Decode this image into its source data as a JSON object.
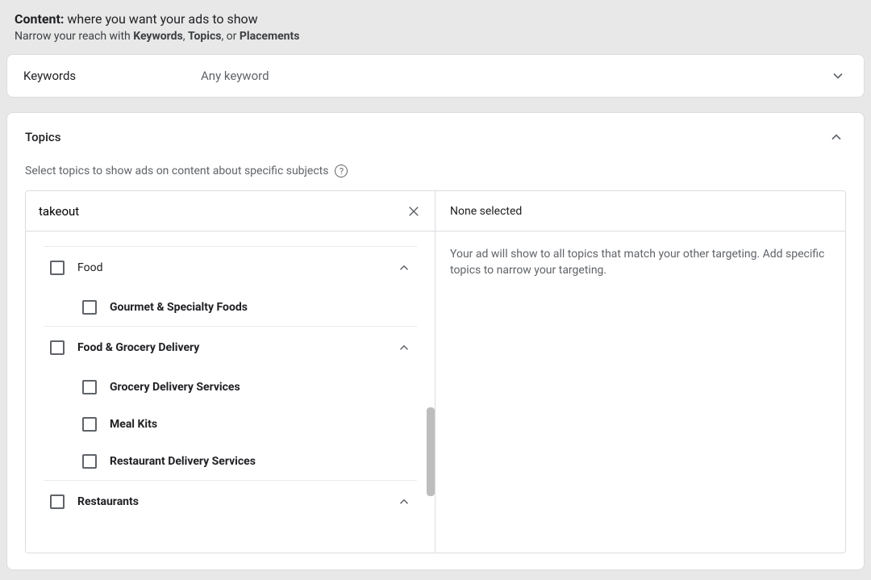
{
  "header": {
    "title_bold": "Content:",
    "title_rest": " where you want your ads to show",
    "sub_prefix": "Narrow your reach with ",
    "sub_k": "Keywords",
    "sub_sep1": ", ",
    "sub_t": "Topics",
    "sub_sep2": ", or ",
    "sub_p": "Placements"
  },
  "keywords": {
    "label": "Keywords",
    "value": "Any keyword"
  },
  "topics": {
    "title": "Topics",
    "desc": "Select topics to show ads on content about specific subjects",
    "search_value": "takeout",
    "tree": {
      "food": "Food",
      "gourmet": "Gourmet & Specialty Foods",
      "fgd": "Food & Grocery Delivery",
      "grocery": "Grocery Delivery Services",
      "mealkits": "Meal Kits",
      "restdeliv": "Restaurant Delivery Services",
      "restaurants": "Restaurants"
    },
    "right_head": "None selected",
    "right_body": "Your ad will show to all topics that match your other targeting. Add specific topics to narrow your targeting."
  },
  "icons": {
    "help": "?"
  }
}
